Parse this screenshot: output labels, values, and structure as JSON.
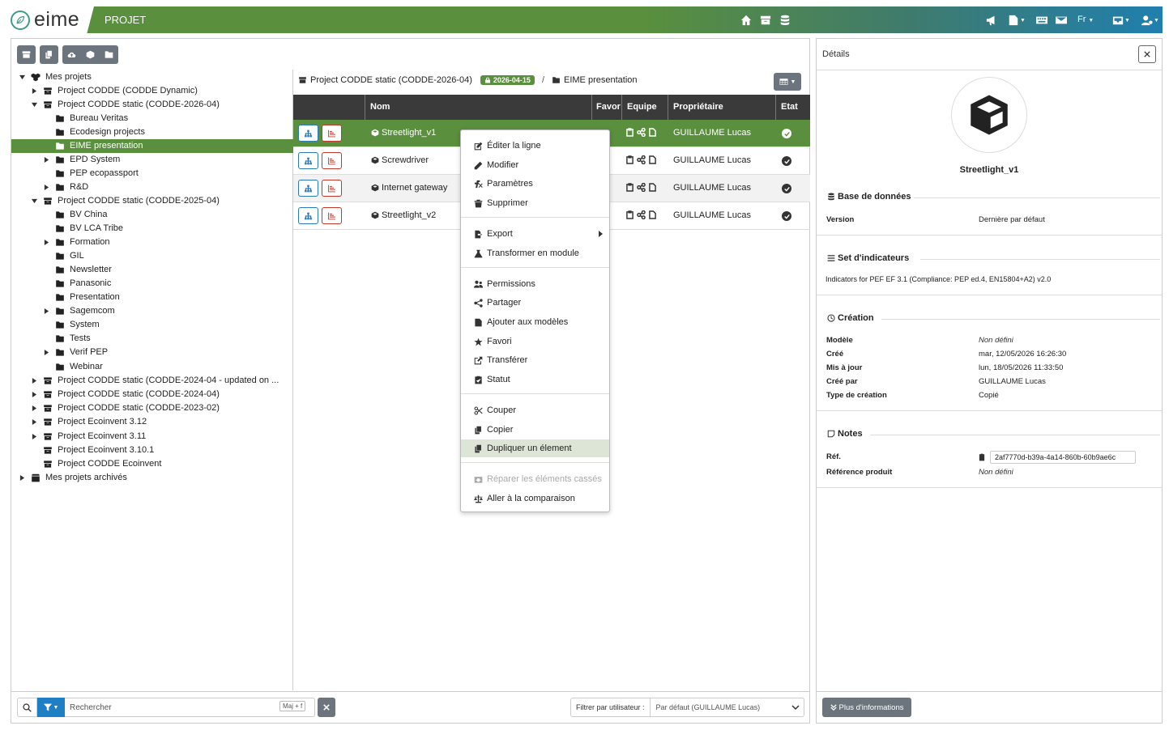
{
  "app": {
    "logo_text": "eime",
    "module_title": "PROJET",
    "language": "Fr",
    "header_icons": [
      "home-icon",
      "archive-icon",
      "database-icon",
      "bullhorn-icon",
      "file-dropdown-icon",
      "keyboard-icon",
      "envelope-icon",
      "inbox-dropdown-icon",
      "user-settings-dropdown-icon"
    ],
    "brand_colors": {
      "primary": "#5a8f3d",
      "secondary": "#1f7fae",
      "dark": "#3a3a3a",
      "grey_button": "#6c757d"
    }
  },
  "toolbar": {
    "icons": [
      "archive-icon",
      "copy-icon",
      "cloud-upload-icon",
      "cube-icon",
      "folder-icon"
    ]
  },
  "tree": {
    "items": [
      {
        "label": "Mes projets"
      },
      {
        "label": "Project CODDE (CODDE Dynamic)"
      },
      {
        "label": "Project CODDE static (CODDE-2026-04)"
      },
      {
        "label": "Bureau Veritas"
      },
      {
        "label": "Ecodesign projects"
      },
      {
        "label": "EIME presentation"
      },
      {
        "label": "EPD System"
      },
      {
        "label": "PEP ecopassport"
      },
      {
        "label": "R&D"
      },
      {
        "label": "Project CODDE static (CODDE-2025-04)"
      },
      {
        "label": "BV China"
      },
      {
        "label": "BV LCA Tribe"
      },
      {
        "label": "Formation"
      },
      {
        "label": "GIL"
      },
      {
        "label": "Newsletter"
      },
      {
        "label": "Panasonic"
      },
      {
        "label": "Presentation"
      },
      {
        "label": "Sagemcom"
      },
      {
        "label": "System"
      },
      {
        "label": "Tests"
      },
      {
        "label": "Verif PEP"
      },
      {
        "label": "Webinar"
      },
      {
        "label": "Project CODDE static (CODDE-2024-04 - updated on ..."
      },
      {
        "label": "Project CODDE static (CODDE-2024-04)"
      },
      {
        "label": "Project CODDE static (CODDE-2023-02)"
      },
      {
        "label": "Project Ecoinvent 3.12"
      },
      {
        "label": "Project Ecoinvent 3.11"
      },
      {
        "label": "Project Ecoinvent 3.10.1"
      },
      {
        "label": "Project CODDE Ecoinvent"
      },
      {
        "label": "Mes projets archivés"
      }
    ]
  },
  "breadcrumb": {
    "project": "Project CODDE static (CODDE-2026-04)",
    "badge": "2026-04-15",
    "separator": "/",
    "folder": "EIME presentation"
  },
  "grid": {
    "columns": [
      "Nom",
      "Favor",
      "Equipe",
      "Propriétaire",
      "Etat"
    ],
    "rows": [
      {
        "name": "Streetlight_v1",
        "owner": "GUILLAUME Lucas"
      },
      {
        "name": "Screwdriver",
        "owner": "GUILLAUME Lucas"
      },
      {
        "name": "Internet gateway",
        "owner": "GUILLAUME Lucas"
      },
      {
        "name": "Streetlight_v2",
        "owner": "GUILLAUME Lucas"
      }
    ]
  },
  "context_menu": {
    "items": [
      {
        "label": "Éditer la ligne",
        "icon": "edit-icon"
      },
      {
        "label": "Modifier",
        "icon": "pencil-icon"
      },
      {
        "label": "Paramètres",
        "icon": "function-icon"
      },
      {
        "label": "Supprimer",
        "icon": "trash-icon"
      },
      {
        "label": "Export",
        "icon": "file-export-icon"
      },
      {
        "label": "Transformer en module",
        "icon": "flask-icon"
      },
      {
        "label": "Permissions",
        "icon": "users-icon"
      },
      {
        "label": "Partager",
        "icon": "share-icon"
      },
      {
        "label": "Ajouter aux modèles",
        "icon": "file-icon"
      },
      {
        "label": "Favori",
        "icon": "star-icon"
      },
      {
        "label": "Transférer",
        "icon": "transfer-icon"
      },
      {
        "label": "Statut",
        "icon": "clipboard-check-icon"
      },
      {
        "label": "Couper",
        "icon": "scissors-icon"
      },
      {
        "label": "Copier",
        "icon": "copy-icon"
      },
      {
        "label": "Dupliquer un élement",
        "icon": "duplicate-icon"
      },
      {
        "label": "Réparer les éléments cassés",
        "icon": "repair-icon"
      },
      {
        "label": "Aller à la comparaison",
        "icon": "balance-icon"
      }
    ]
  },
  "search": {
    "placeholder": "Rechercher",
    "shortcut": "Maj + f",
    "filter_user_label": "Filtrer par utilisateur :",
    "filter_user_value": "Par défaut (GUILLAUME Lucas)"
  },
  "details": {
    "title": "Détails",
    "name": "Streetlight_v1",
    "db_section": "Base de données",
    "version_label": "Version",
    "version_value": "Dernière par défaut",
    "ind_section": "Set d'indicateurs",
    "ind_value": "Indicators for PEF EF 3.1 (Compliance: PEP ed.4, EN15804+A2) v2.0",
    "creation_section": "Création",
    "modele_label": "Modèle",
    "modele_value": "Non défini",
    "cree_label": "Créé",
    "cree_value": "mar, 12/05/2026 16:26:30",
    "maj_label": "Mis à jour",
    "maj_value": "lun, 18/05/2026 11:33:50",
    "creepar_label": "Créé par",
    "creepar_value": "GUILLAUME Lucas",
    "type_label": "Type de création",
    "type_value": "Copié",
    "notes_section": "Notes",
    "ref_label": "Réf.",
    "ref_value": "2af7770d-b39a-4a14-860b-60b9ae6c",
    "refprod_label": "Référence produit",
    "refprod_value": "Non défini",
    "more_button": "Plus d'informations"
  }
}
